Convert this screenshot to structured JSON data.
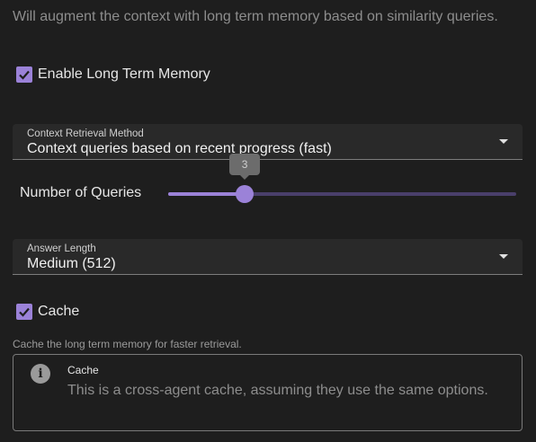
{
  "description": "Will augment the context with long term memory based on similarity queries.",
  "enable_ltm": {
    "label": "Enable Long Term Memory",
    "checked": true
  },
  "retrieval_method": {
    "label": "Context Retrieval Method",
    "value": "Context queries based on recent progress (fast)"
  },
  "num_queries": {
    "label": "Number of Queries",
    "value": "3",
    "fraction": 0.22
  },
  "answer_length": {
    "label": "Answer Length",
    "value": "Medium (512)"
  },
  "cache": {
    "label": "Cache",
    "checked": true,
    "helper": "Cache the long term memory for faster retrieval."
  },
  "info": {
    "icon": "info-icon",
    "title": "Cache",
    "text": "This is a cross-agent cache, assuming they use the same options."
  },
  "colors": {
    "accent": "#9b82d8",
    "background": "#1e1e1e",
    "track": "#4a3f6b"
  }
}
